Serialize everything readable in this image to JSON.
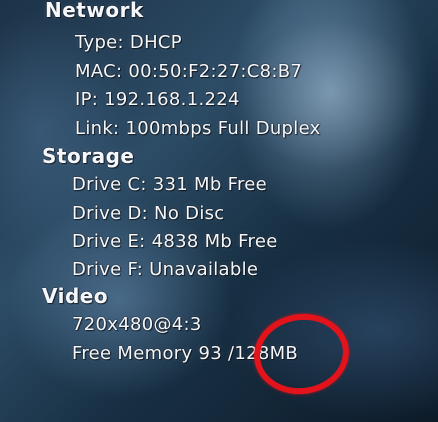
{
  "network": {
    "heading": "Network",
    "type": "Type: DHCP",
    "mac": "MAC: 00:50:F2:27:C8:B7",
    "ip": "IP: 192.168.1.224",
    "link": "Link: 100mbps Full Duplex"
  },
  "storage": {
    "heading": "Storage",
    "drives": [
      "Drive C: 331 Mb Free",
      "Drive D: No Disc",
      "Drive E: 4838 Mb Free",
      "Drive F: Unavailable"
    ]
  },
  "video": {
    "heading": "Video",
    "resolution": "720x480@4:3",
    "free_memory": "Free Memory 93 /128MB"
  },
  "annotation": {
    "color": "#e2131b"
  }
}
